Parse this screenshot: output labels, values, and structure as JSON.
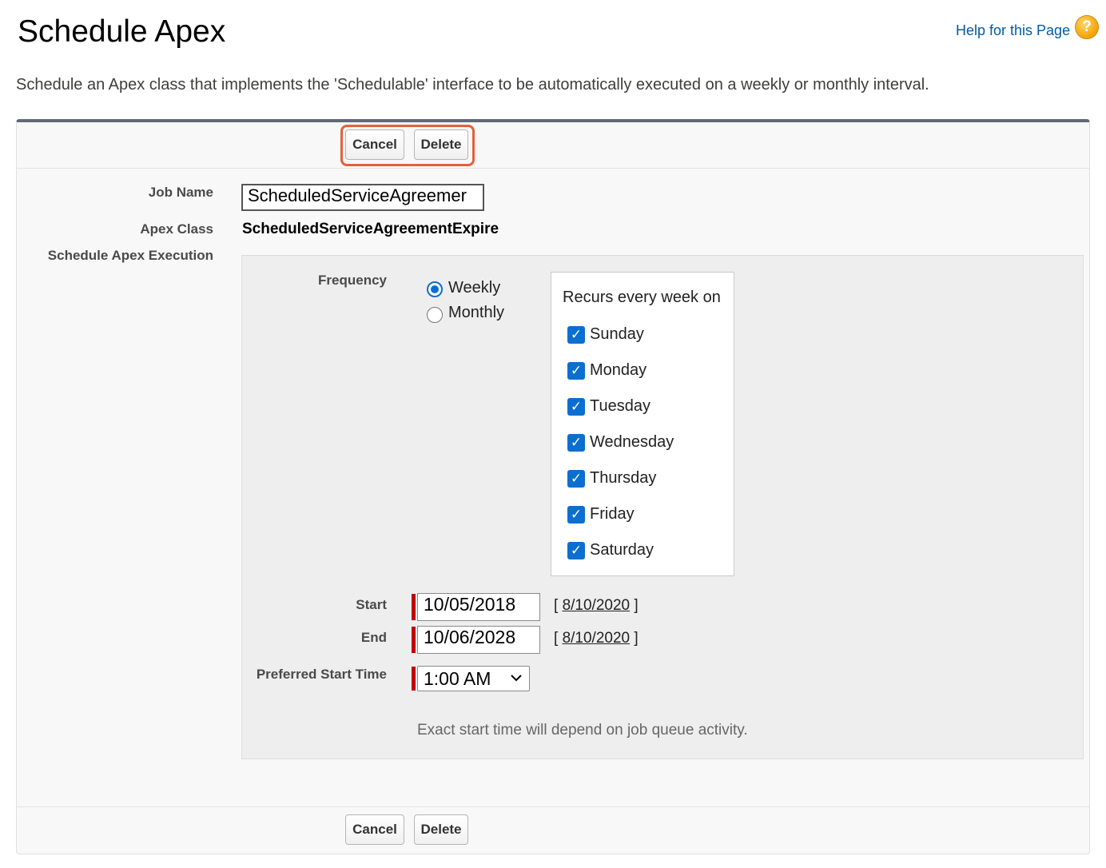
{
  "header": {
    "title": "Schedule Apex",
    "help_link": "Help for this Page",
    "help_icon": "question-icon",
    "description": "Schedule an Apex class that implements the 'Schedulable' interface to be automatically executed on a weekly or monthly interval."
  },
  "toolbar": {
    "cancel_label": "Cancel",
    "delete_label": "Delete"
  },
  "form": {
    "job_name_label": "Job Name",
    "job_name_value": "ScheduledServiceAgreemer",
    "apex_class_label": "Apex Class",
    "apex_class_value": "ScheduledServiceAgreementExpire",
    "schedule_label": "Schedule Apex Execution",
    "frequency_label": "Frequency",
    "frequency_options": [
      "Weekly",
      "Monthly"
    ],
    "frequency_selected": "Weekly",
    "recurs_title": "Recurs every week on",
    "days": [
      {
        "label": "Sunday",
        "checked": true
      },
      {
        "label": "Monday",
        "checked": true
      },
      {
        "label": "Tuesday",
        "checked": true
      },
      {
        "label": "Wednesday",
        "checked": true
      },
      {
        "label": "Thursday",
        "checked": true
      },
      {
        "label": "Friday",
        "checked": true
      },
      {
        "label": "Saturday",
        "checked": true
      }
    ],
    "start_label": "Start",
    "start_value": "10/05/2018",
    "start_today": "8/10/2020",
    "end_label": "End",
    "end_value": "10/06/2028",
    "end_today": "8/10/2020",
    "preferred_time_label": "Preferred Start Time",
    "preferred_time_value": "1:00 AM",
    "note": "Exact start time will depend on job queue activity."
  },
  "colors": {
    "link": "#015ba7",
    "checkbox": "#0b6fd1",
    "required": "#c00000",
    "highlight": "#e5603b",
    "panel_top_border": "#5f6b7a"
  }
}
